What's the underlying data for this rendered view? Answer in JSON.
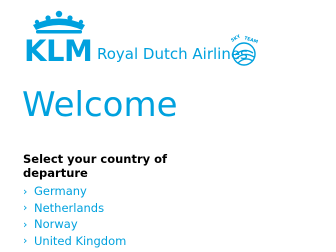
{
  "brand": {
    "wordmark": "KLM",
    "name": "Royal Dutch Airlines",
    "alliance_logo": "skyteam-icon",
    "crown_icon": "crown-icon",
    "color": "#00a1de"
  },
  "main": {
    "title": "Welcome",
    "select_heading": "Select your country of departure",
    "countries": [
      {
        "label": "Germany"
      },
      {
        "label": "Netherlands"
      },
      {
        "label": "Norway"
      },
      {
        "label": "United Kingdom"
      }
    ]
  }
}
